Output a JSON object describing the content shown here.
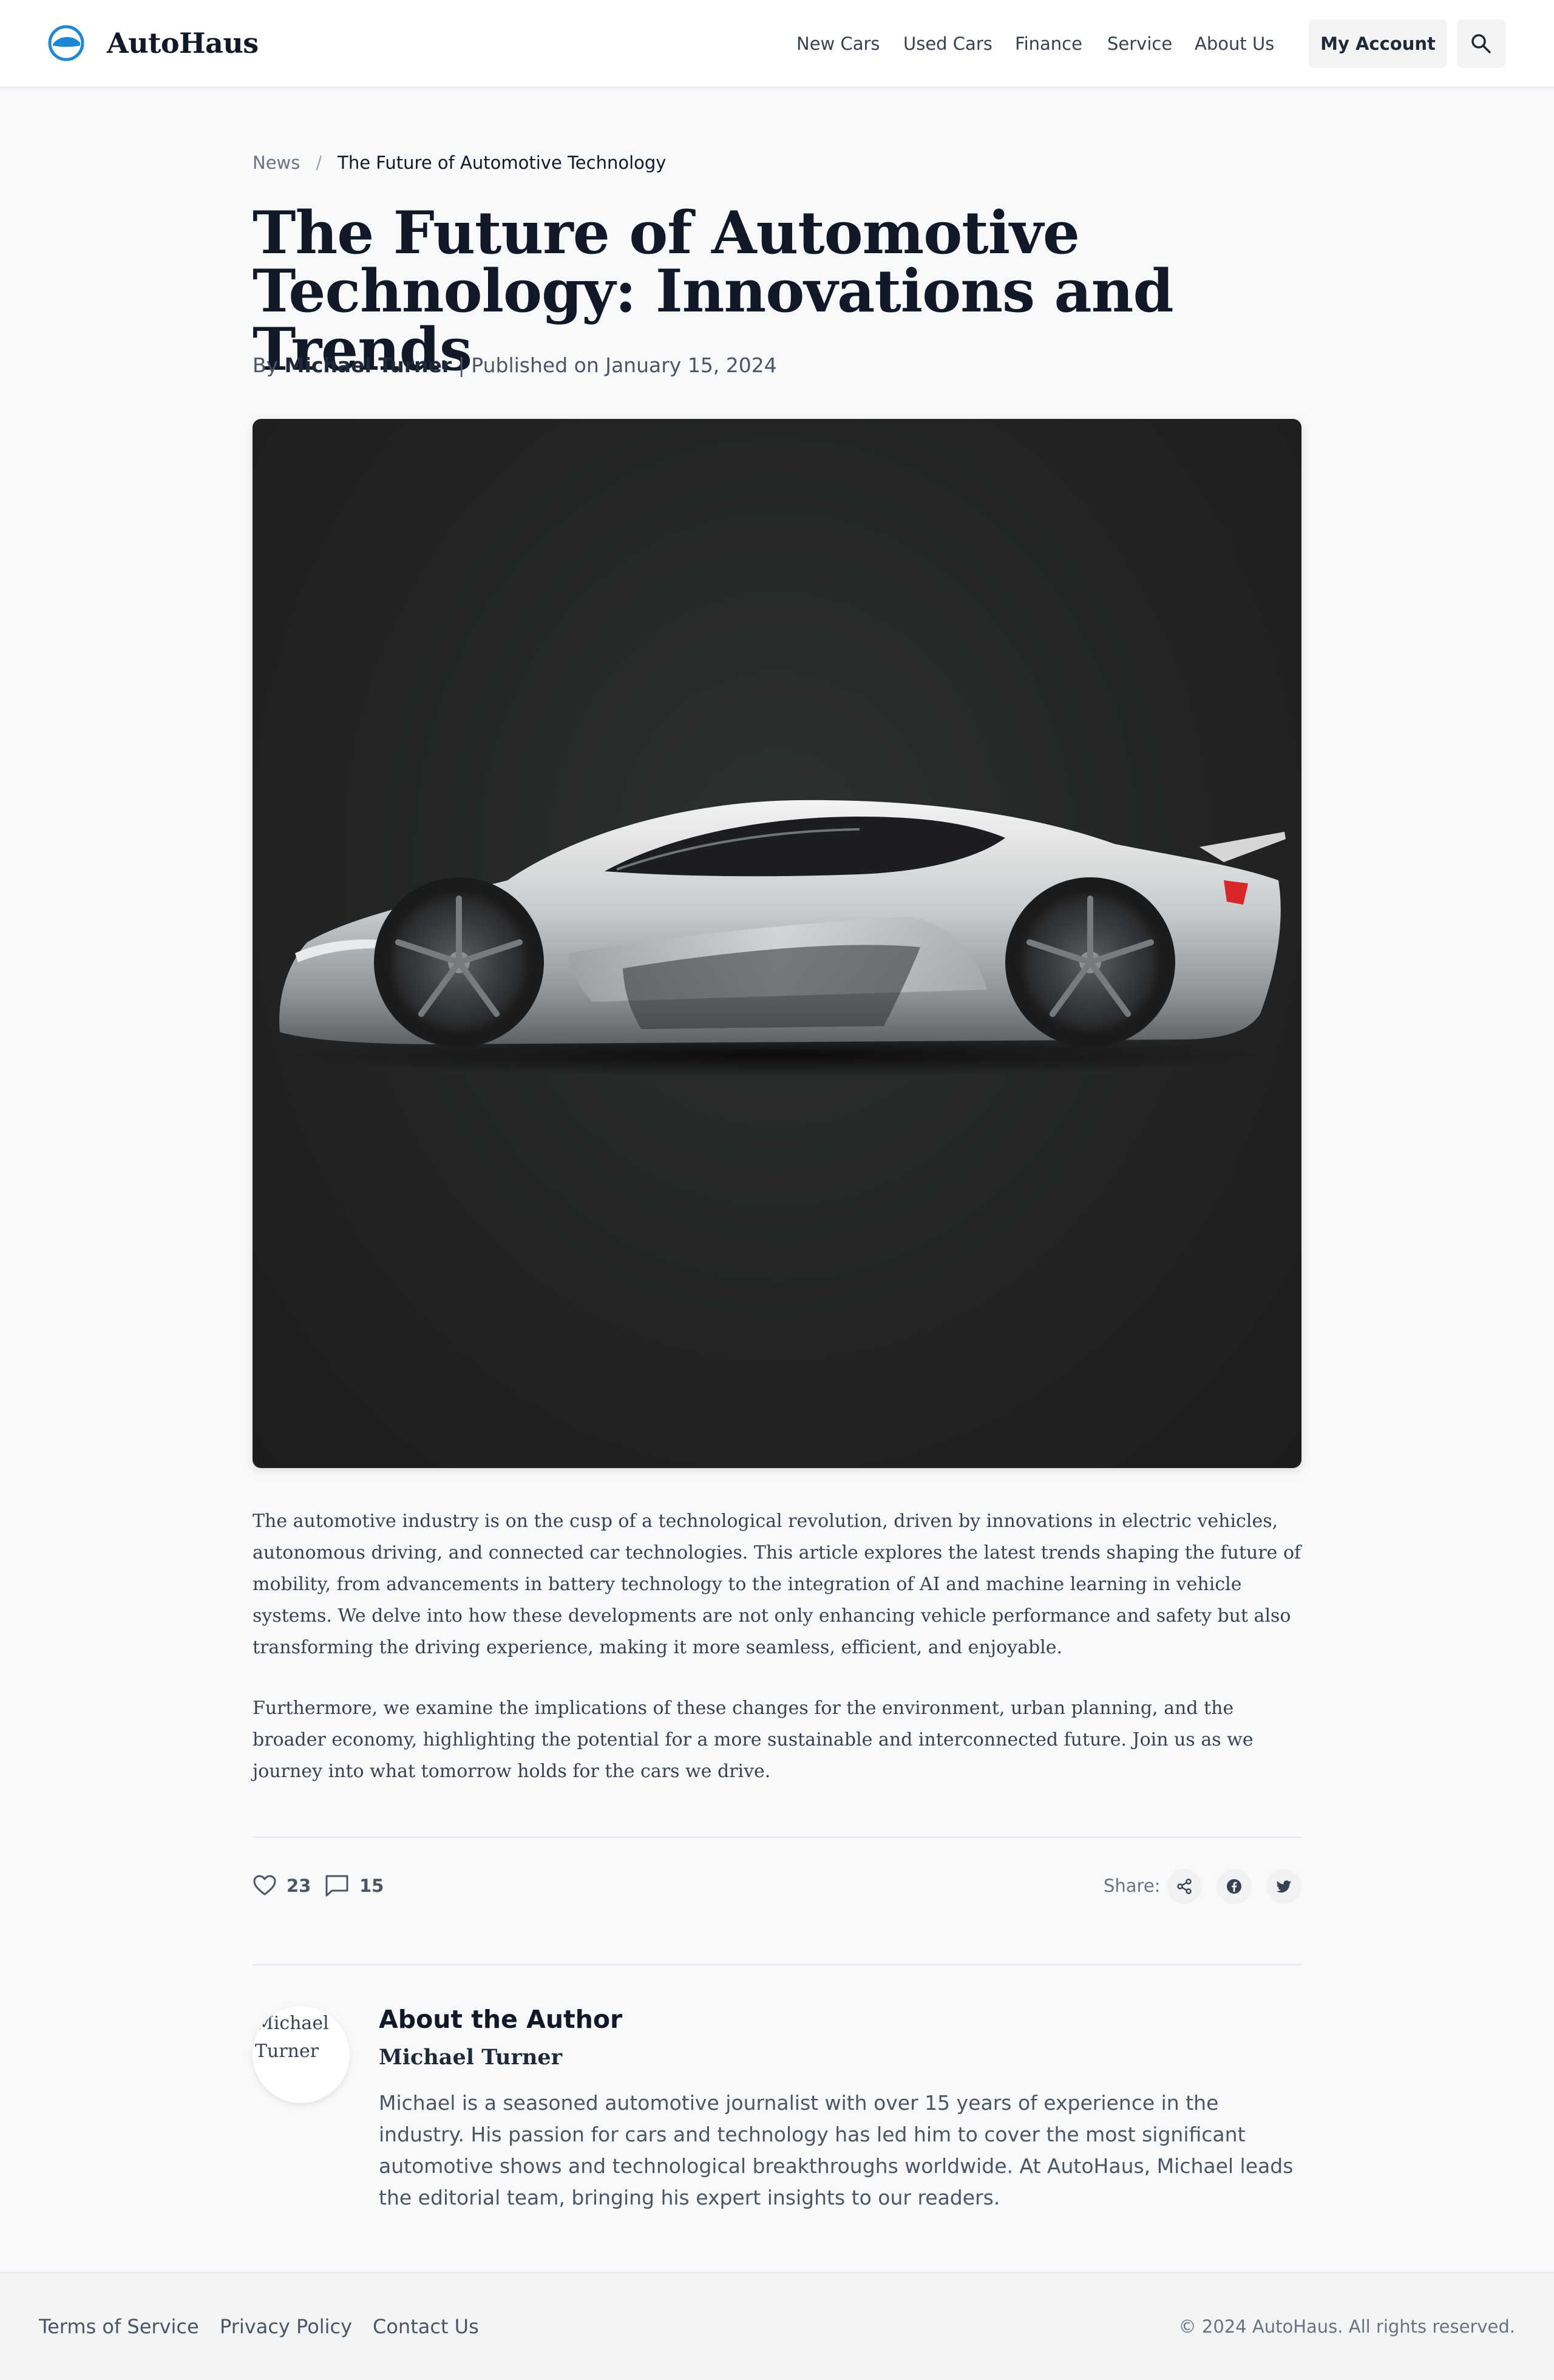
{
  "header": {
    "brand": "AutoHaus",
    "nav": [
      "New Cars",
      "Used Cars",
      "Finance",
      "Service",
      "About Us"
    ],
    "account_label": "My Account",
    "logo_icon": "car-logo-icon",
    "search_icon": "search-icon"
  },
  "breadcrumb": {
    "parent": "News",
    "separator": "/",
    "current": "The Future of Automotive Technology"
  },
  "article": {
    "title": "The Future of Automotive Technology: Innovations and Trends",
    "byline_prefix": "By",
    "author": "Michael Turner",
    "byline_sep": "|",
    "published": "Published on January 15, 2024",
    "paragraphs": [
      "The automotive industry is on the cusp of a technological revolution, driven by innovations in electric vehicles, autonomous driving, and connected car technologies. This article explores the latest trends shaping the future of mobility, from advancements in battery technology to the integration of AI and machine learning in vehicle systems. We delve into how these developments are not only enhancing vehicle performance and safety but also transforming the driving experience, making it more seamless, efficient, and enjoyable.",
      "Furthermore, we examine the implications of these changes for the environment, urban planning, and the broader economy, highlighting the potential for a more sustainable and interconnected future. Join us as we journey into what tomorrow holds for the cars we drive."
    ]
  },
  "engagement": {
    "likes": "23",
    "comments": "15",
    "share_label": "Share:",
    "share_icons": [
      "share-icon",
      "facebook-icon",
      "twitter-icon"
    ]
  },
  "author_box": {
    "heading": "About the Author",
    "name": "Michael Turner",
    "avatar_alt": "Michael Turner",
    "bio": "Michael is a seasoned automotive journalist with over 15 years of experience in the industry. His passion for cars and technology has led him to cover the most significant automotive shows and technological breakthroughs worldwide. At AutoHaus, Michael leads the editorial team, bringing his expert insights to our readers."
  },
  "footer": {
    "links": [
      "Terms of Service",
      "Privacy Policy",
      "Contact Us"
    ],
    "copyright": "© 2024 AutoHaus. All rights reserved."
  },
  "colors": {
    "brand_accent": "#1e88d6",
    "title_text": "#111827",
    "page_background": "#f8f9fb",
    "hero_background": "#232526"
  }
}
